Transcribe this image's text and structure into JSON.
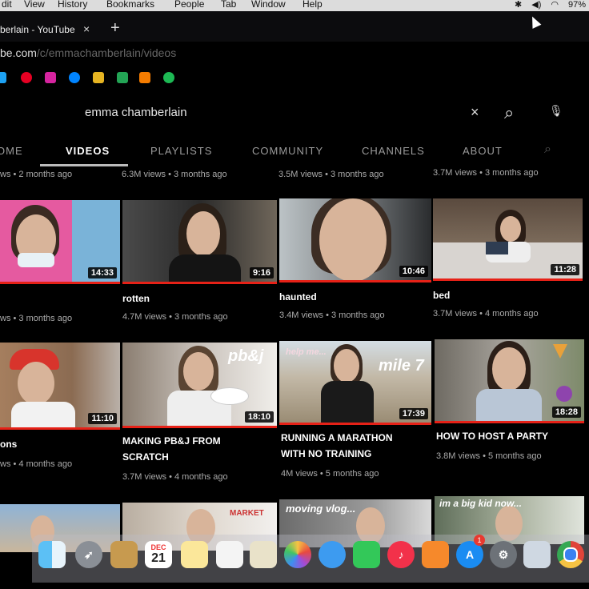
{
  "menubar": {
    "items": [
      "dit",
      "View",
      "History",
      "Bookmarks",
      "People",
      "Tab",
      "Window",
      "Help"
    ],
    "battery": "97%"
  },
  "tab": {
    "title": "berlain - YouTube",
    "close": "×",
    "new_tab": "+"
  },
  "address": {
    "host": "be.com",
    "path": "/c/emmachamberlain/videos"
  },
  "search": {
    "query": "emma chamberlain",
    "clear": "×",
    "search_glyph": "⌕",
    "mic_glyph": "🎙"
  },
  "channel_tabs": [
    "OME",
    "VIDEOS",
    "PLAYLISTS",
    "COMMUNITY",
    "CHANNELS",
    "ABOUT"
  ],
  "top_meta": [
    "ws • 2 months ago",
    "6.3M views • 3 months ago",
    "3.5M views • 3 months ago",
    "3.7M views • 3 months ago"
  ],
  "row1": [
    {
      "duration": "14:33",
      "title": "",
      "meta": "ws • 3 months ago"
    },
    {
      "duration": "9:16",
      "title": "rotten",
      "meta": "4.7M views • 3 months ago"
    },
    {
      "duration": "10:46",
      "title": "haunted",
      "meta": "3.4M views • 3 months ago"
    },
    {
      "duration": "11:28",
      "title": "bed",
      "meta": "3.7M views • 4 months ago"
    }
  ],
  "row2": [
    {
      "duration": "11:10",
      "title": "ons",
      "title2": "",
      "meta": "ws • 4 months ago"
    },
    {
      "duration": "18:10",
      "title": "MAKING PB&J FROM",
      "title2": "SCRATCH",
      "meta": "3.7M views • 4 months ago",
      "overlay": "pb&j"
    },
    {
      "duration": "17:39",
      "title": "RUNNING A MARATHON",
      "title2": "WITH NO TRAINING",
      "meta": "4M views • 5 months ago",
      "overlay": "mile 7",
      "overlay2": "help me..."
    },
    {
      "duration": "18:28",
      "title": "HOW TO HOST A PARTY",
      "title2": "",
      "meta": "3.8M views • 5 months ago"
    }
  ],
  "row3": [
    {
      "overlay": ""
    },
    {
      "overlay": "MARKET"
    },
    {
      "overlay": "moving vlog..."
    },
    {
      "overlay": "im a big kid now..."
    }
  ],
  "dock": {
    "calendar_month": "DEC",
    "calendar_day": "21",
    "appstore_badge": "1",
    "icons": [
      "finder-icon",
      "launchpad-icon",
      "notes-icon",
      "calendar-icon",
      "stickies-icon",
      "reminders-icon",
      "preview-icon",
      "photos-icon",
      "messages-icon",
      "facetime-icon",
      "music-icon",
      "books-icon",
      "app-store-icon",
      "system-preferences-icon",
      "screenshot-icon",
      "chrome-icon"
    ]
  },
  "colors": {
    "accent_red": "#e62117",
    "background": "#000000"
  }
}
